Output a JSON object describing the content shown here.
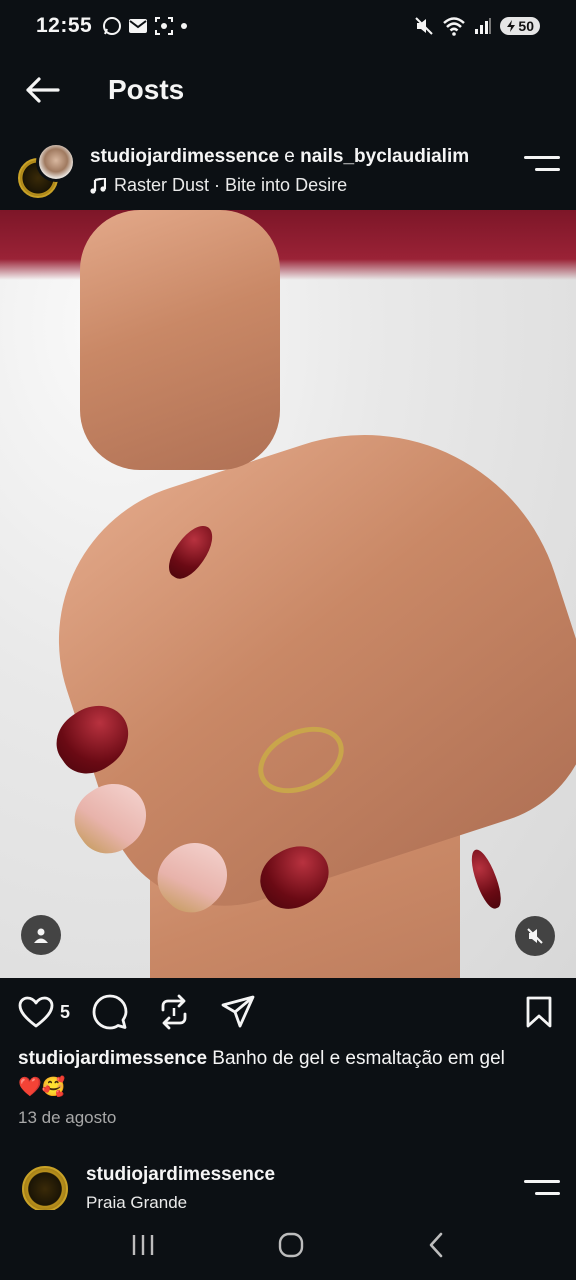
{
  "status_bar": {
    "time": "12:55",
    "battery": "50",
    "left_icons": [
      "whatsapp-icon",
      "mail-icon",
      "screenshot-icon",
      "dot-icon"
    ],
    "right_icons": [
      "mute-icon",
      "wifi-icon",
      "signal-icon",
      "battery-icon"
    ]
  },
  "top_bar": {
    "title": "Posts"
  },
  "post": {
    "author": "studiojardimessence",
    "connector": " e ",
    "collaborator": "nails_byclaudialim",
    "audio": "Raster Dust · Bite into Desire",
    "like_count": "5",
    "caption_user": "studiojardimessence",
    "caption_text": " Banho de gel e esmaltação em gel",
    "caption_emoji": "❤️🥰",
    "date": "13 de agosto"
  },
  "next_post": {
    "author": "studiojardimessence",
    "location": "Praia Grande"
  },
  "colors": {
    "background": "#0c1014",
    "text": "#f5f5f5",
    "muted": "#a8a8a8"
  }
}
